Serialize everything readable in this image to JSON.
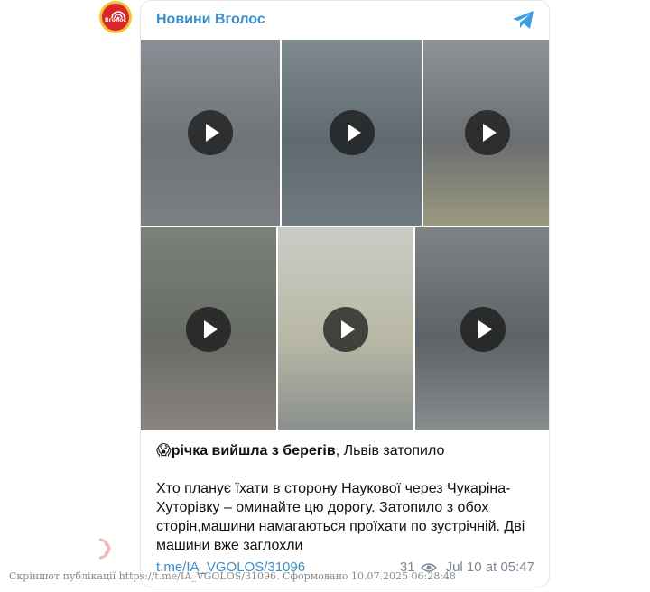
{
  "channel": {
    "name": "Новини Вголос",
    "avatar_text": "Вголос",
    "brand_color": "#3a8ec7"
  },
  "media": {
    "items": [
      {
        "type": "video",
        "icon": "play-icon",
        "tint": [
          "#8a8f95",
          "#6e7378",
          "#7b7f84"
        ]
      },
      {
        "type": "video",
        "icon": "play-icon",
        "tint": [
          "#7e8a8e",
          "#5f6a70",
          "#6f7b80"
        ]
      },
      {
        "type": "video",
        "icon": "play-icon",
        "tint": [
          "#8f9395",
          "#6b6e70",
          "#9b9a80"
        ]
      },
      {
        "type": "video",
        "icon": "play-icon",
        "tint": [
          "#7a8178",
          "#686b66",
          "#8a8480"
        ]
      },
      {
        "type": "video",
        "icon": "play-icon",
        "tint": [
          "#c9ccc5",
          "#b9b8a6",
          "#8a8f8c"
        ]
      },
      {
        "type": "video",
        "icon": "play-icon",
        "tint": [
          "#7e8384",
          "#5d6366",
          "#888c8d"
        ]
      }
    ]
  },
  "post": {
    "emoji": "😱",
    "headline_bold": "річка вийшла з берегів",
    "headline_rest": ", Львів затопило",
    "body": "Хто планує їхати в сторону Наукової через Чукаріна-Хуторівку – оминайте цю дорогу. Затопило з обох сторін,машини намагаються проїхати по зустрічній. Дві машини вже заглохли"
  },
  "footer": {
    "link": "t.me/IA_VGOLOS/31096",
    "views": "31",
    "date": "Jul 10 at 05:47"
  },
  "caption": "Скріншот публікації https://t.me/IA_VGOLOS/31096. Сформовано 10.07.2025 06:28:48"
}
